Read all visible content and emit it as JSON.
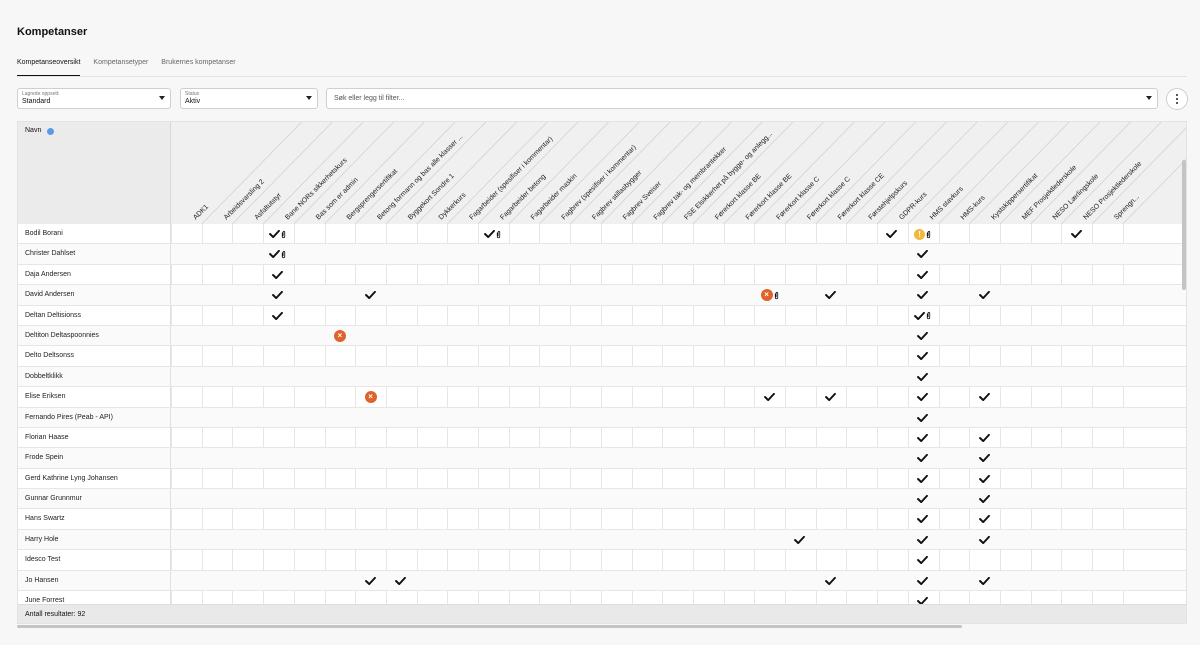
{
  "page": {
    "title": "Kompetanser"
  },
  "tabs": [
    {
      "label": "Kompetanseoversikt",
      "active": true
    },
    {
      "label": "Kompetansetyper",
      "active": false
    },
    {
      "label": "Brukernes kompetanser",
      "active": false
    }
  ],
  "filters": {
    "saved_setup": {
      "label": "Lagrede oppsett:",
      "value": "Standard"
    },
    "status": {
      "label": "Status",
      "value": "Aktiv"
    },
    "search": {
      "placeholder": "Søk eller legg til filter..."
    }
  },
  "table": {
    "name_header": "Navn",
    "columns": [
      "ADK1",
      "Arbeidsvarsling 2",
      "Asfaltutstyr",
      "Bane NORs sikkerhetskurs",
      "Bas som er admin",
      "Bergsprengersertifikat",
      "Betong formann og bas alle klasser ...",
      "Byggekort Sondre 1",
      "Dykkerkurs",
      "Fagarbeider (spesifiser i kommentar)",
      "Fagarbeider betong",
      "Fagarbeider maskin",
      "Fagbrev (spesifiser i kommentar)",
      "Fagbrev stillasbygger",
      "Fagbrev Sveiser",
      "Fagbrev tak- og membrantekker",
      "FSE Elsikkerhet på bygge- og anlegg...",
      "Førerkort klasse BE",
      "Førerkort klasse BE",
      "Førerkort klasse C",
      "Førerkort klasse C",
      "Førerkort klasse CE",
      "Førstehjelpskurs",
      "GDPR-kurs",
      "HMS stavkurs",
      "HMS-kurs",
      "Kystskippersertifikat",
      "MEF Prosjektlederskole",
      "NESO Lærlingskole",
      "NESO Prosjektlederskole",
      "Sprengn..."
    ],
    "rows": [
      {
        "name": "Bodil Borani",
        "marks": [
          [
            3,
            "check-clip"
          ],
          [
            10,
            "check-clip"
          ],
          [
            23,
            "check"
          ],
          [
            24,
            "warn-clip"
          ],
          [
            29,
            "check"
          ]
        ]
      },
      {
        "name": "Christer Dahlset",
        "marks": [
          [
            3,
            "check-clip"
          ],
          [
            24,
            "check"
          ]
        ]
      },
      {
        "name": "Daja Andersen",
        "marks": [
          [
            3,
            "check"
          ],
          [
            24,
            "check"
          ]
        ]
      },
      {
        "name": "David Andersen",
        "marks": [
          [
            3,
            "check"
          ],
          [
            6,
            "check"
          ],
          [
            19,
            "x-clip"
          ],
          [
            21,
            "check"
          ],
          [
            24,
            "check"
          ],
          [
            26,
            "check"
          ]
        ]
      },
      {
        "name": "Deltan Deltisionss",
        "marks": [
          [
            3,
            "check"
          ],
          [
            24,
            "check-clip"
          ]
        ]
      },
      {
        "name": "Deltiton Deltaspoonnies",
        "marks": [
          [
            5,
            "x"
          ],
          [
            24,
            "check"
          ]
        ]
      },
      {
        "name": "Delto Deltsonss",
        "marks": [
          [
            24,
            "check"
          ]
        ]
      },
      {
        "name": "Dobbeltklikk",
        "marks": [
          [
            24,
            "check"
          ]
        ]
      },
      {
        "name": "Elise Eriksen",
        "marks": [
          [
            6,
            "x"
          ],
          [
            19,
            "check"
          ],
          [
            21,
            "check"
          ],
          [
            24,
            "check"
          ],
          [
            26,
            "check"
          ]
        ]
      },
      {
        "name": "Fernando Pires (Peab - API)",
        "marks": [
          [
            24,
            "check"
          ]
        ]
      },
      {
        "name": "Florian Haase",
        "marks": [
          [
            24,
            "check"
          ],
          [
            26,
            "check"
          ]
        ]
      },
      {
        "name": "Frode Spein",
        "marks": [
          [
            24,
            "check"
          ],
          [
            26,
            "check"
          ]
        ]
      },
      {
        "name": "Gerd Kathrine Lyng Johansen",
        "marks": [
          [
            24,
            "check"
          ],
          [
            26,
            "check"
          ]
        ]
      },
      {
        "name": "Gunnar Grunnmur",
        "marks": [
          [
            24,
            "check"
          ],
          [
            26,
            "check"
          ]
        ]
      },
      {
        "name": "Hans Swartz",
        "marks": [
          [
            24,
            "check"
          ],
          [
            26,
            "check"
          ]
        ]
      },
      {
        "name": "Harry Hole",
        "marks": [
          [
            20,
            "check"
          ],
          [
            24,
            "check"
          ],
          [
            26,
            "check"
          ]
        ]
      },
      {
        "name": "Idesco Test",
        "marks": [
          [
            24,
            "check"
          ]
        ]
      },
      {
        "name": "Jo Hansen",
        "marks": [
          [
            6,
            "check"
          ],
          [
            7,
            "check"
          ],
          [
            21,
            "check"
          ],
          [
            24,
            "check"
          ],
          [
            26,
            "check"
          ]
        ]
      },
      {
        "name": "June Forrest",
        "marks": [
          [
            24,
            "check"
          ]
        ]
      }
    ],
    "result_count": "Antall resultater: 92"
  },
  "colors": {
    "accent": "#5b9be6",
    "error": "#e0622b",
    "warning": "#f1b83c"
  }
}
